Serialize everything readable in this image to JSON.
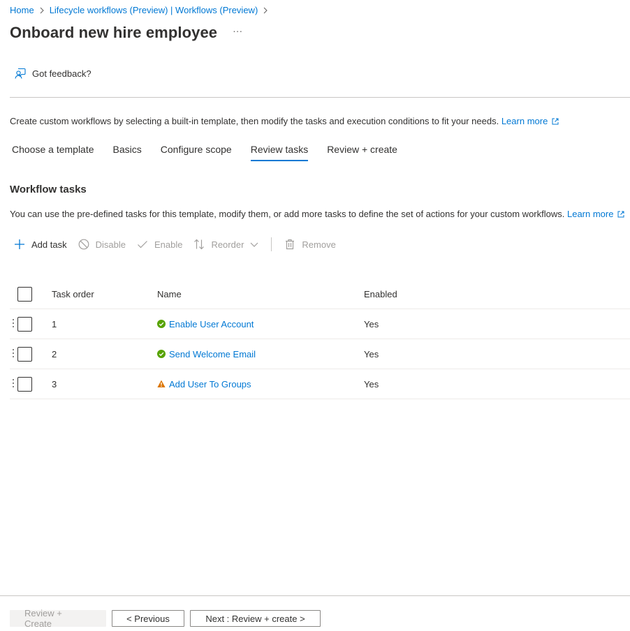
{
  "breadcrumb": [
    {
      "label": "Home"
    },
    {
      "label": "Lifecycle workflows (Preview) | Workflows (Preview)"
    }
  ],
  "page": {
    "title": "Onboard new hire employee",
    "more": "···",
    "feedback": "Got feedback?"
  },
  "intro": {
    "text": "Create custom workflows by selecting a built-in template, then modify the tasks and execution conditions to fit your needs.",
    "link": "Learn more"
  },
  "tabs": [
    {
      "label": "Choose a template",
      "active": false
    },
    {
      "label": "Basics",
      "active": false
    },
    {
      "label": "Configure scope",
      "active": false
    },
    {
      "label": "Review tasks",
      "active": true
    },
    {
      "label": "Review + create",
      "active": false
    }
  ],
  "section": {
    "title": "Workflow tasks",
    "desc": "You can use the pre-defined tasks for this template, modify them, or add more tasks to define the set of actions for your custom workflows.",
    "link": "Learn more"
  },
  "toolbar": {
    "add": "Add task",
    "disable": "Disable",
    "enable": "Enable",
    "reorder": "Reorder",
    "remove": "Remove"
  },
  "table": {
    "headers": {
      "order": "Task order",
      "name": "Name",
      "enabled": "Enabled"
    },
    "rows": [
      {
        "order": "1",
        "name": "Enable User Account",
        "enabled": "Yes",
        "status": "success-icon"
      },
      {
        "order": "2",
        "name": "Send Welcome Email",
        "enabled": "Yes",
        "status": "success-icon"
      },
      {
        "order": "3",
        "name": "Add User To Groups",
        "enabled": "Yes",
        "status": "warning-icon"
      }
    ]
  },
  "footer": {
    "review_create": "Review + Create",
    "previous": "< Previous",
    "next": "Next : Review + create >"
  },
  "colors": {
    "accent": "#0078d4",
    "success": "#57a300",
    "warning": "#db7500"
  }
}
